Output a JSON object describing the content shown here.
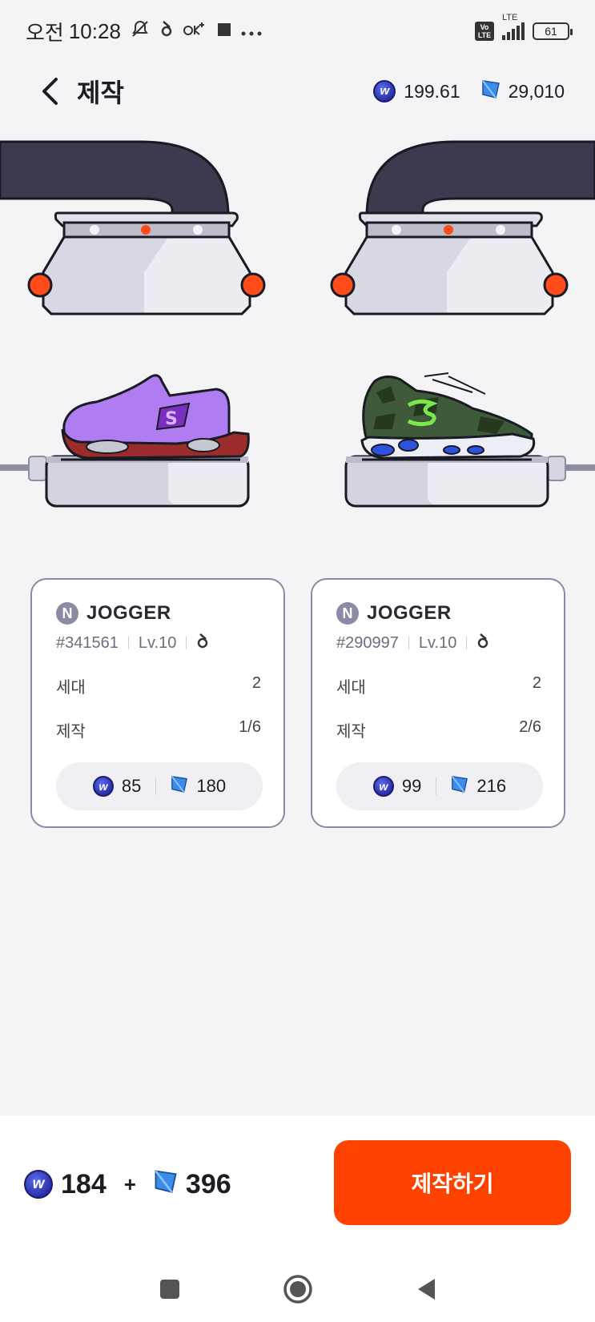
{
  "status_bar": {
    "ampm": "오전",
    "time": "10:28",
    "network_label": "LTE",
    "volte_label": "Vo LTE",
    "battery": "61"
  },
  "header": {
    "title": "제작",
    "coin_balance": "199.61",
    "gem_balance": "29,010"
  },
  "coin_glyph": "w",
  "cards": [
    {
      "badge": "N",
      "type": "JOGGER",
      "id": "#341561",
      "level": "Lv.10",
      "stats": [
        {
          "label": "세대",
          "value": "2"
        },
        {
          "label": "제작",
          "value": "1/6"
        }
      ],
      "cost_coin": "85",
      "cost_gem": "180",
      "shoe_color": "#b07cf2"
    },
    {
      "badge": "N",
      "type": "JOGGER",
      "id": "#290997",
      "level": "Lv.10",
      "stats": [
        {
          "label": "세대",
          "value": "2"
        },
        {
          "label": "제작",
          "value": "2/6"
        }
      ],
      "cost_coin": "99",
      "cost_gem": "216",
      "shoe_color": "#3e5a3a"
    }
  ],
  "footer": {
    "total_coin": "184",
    "plus": "+",
    "total_gem": "396",
    "craft_button": "제작하기"
  },
  "colors": {
    "accent": "#ff4200",
    "machine_dark": "#3c3a4e",
    "card_border": "#8a8aa6"
  }
}
